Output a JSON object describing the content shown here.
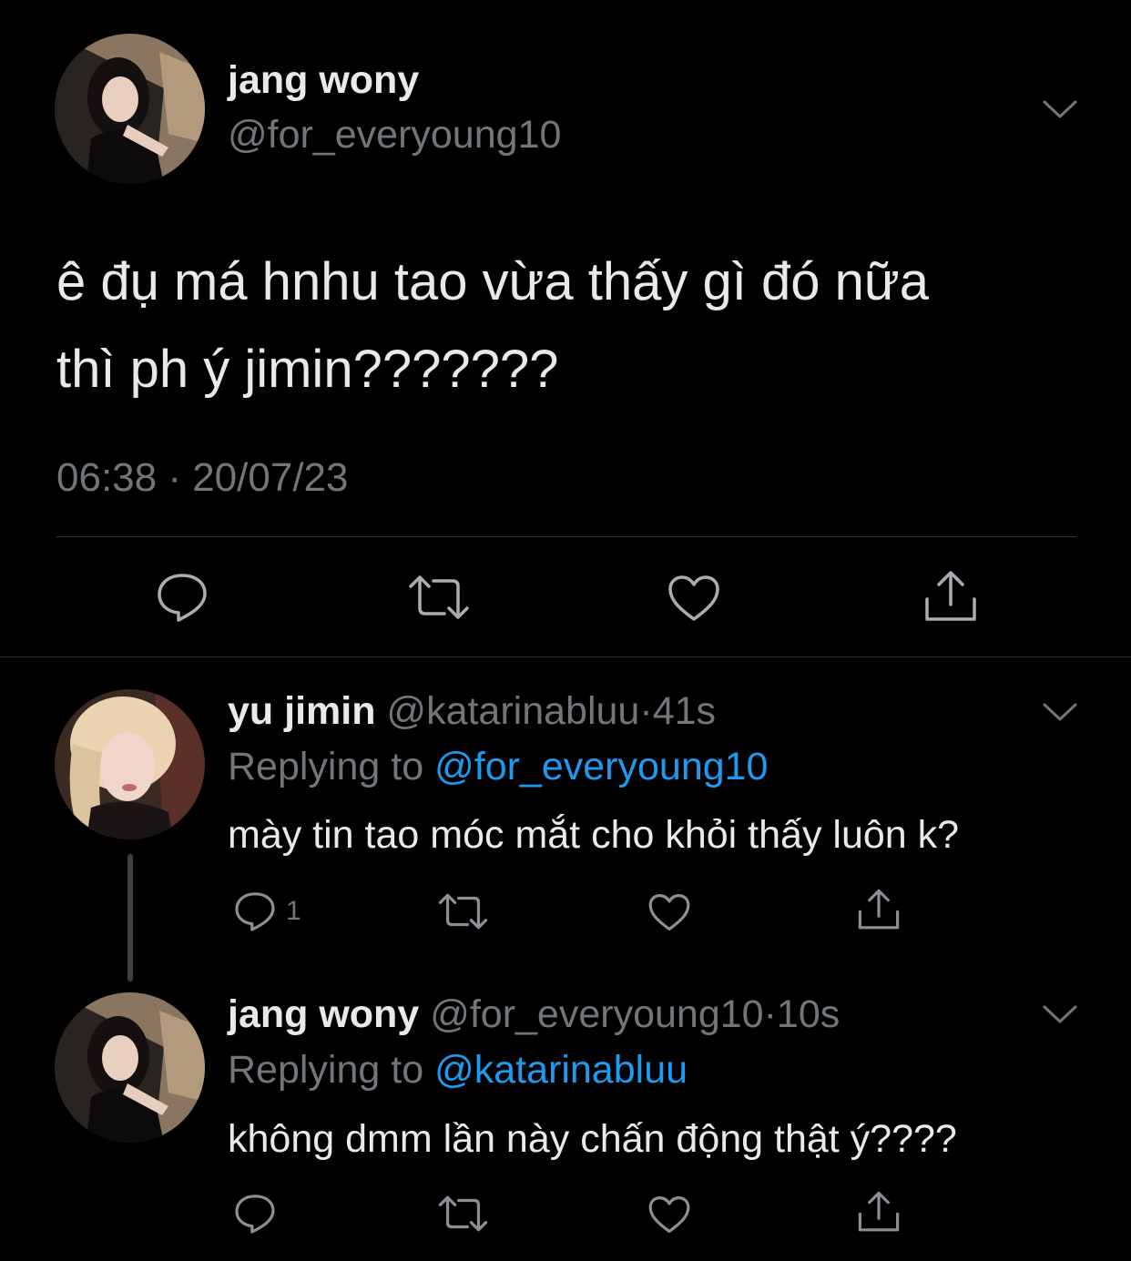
{
  "main_tweet": {
    "author_name": "jang wony",
    "author_handle": "@for_everyoung10",
    "text_line1": "ê đụ má hnhu tao vừa thấy gì đó nữa",
    "text_line2": "thì ph ý jimin???????",
    "timestamp": "06:38 · 20/07/23",
    "avatar_icon": "avatar-photo-jang-wony",
    "actions": [
      "reply-icon",
      "retweet-icon",
      "like-icon",
      "share-icon"
    ]
  },
  "replies": [
    {
      "author_name": "yu jimin",
      "author_handle": "@katarinabluu",
      "separator": "·",
      "time": "41s",
      "replying_prefix": "Replying to",
      "replying_to": "@for_everyoung10",
      "text": "mày tin tao móc mắt cho khỏi thấy luôn k?",
      "reply_count": "1",
      "avatar_icon": "avatar-photo-yu-jimin"
    },
    {
      "author_name": "jang wony",
      "author_handle": "@for_everyoung10",
      "separator": "·",
      "time": "10s",
      "replying_prefix": "Replying to",
      "replying_to": "@katarinabluu",
      "text": "không dmm lần này chấn động thật ý????",
      "reply_count": "",
      "avatar_icon": "avatar-photo-jang-wony"
    }
  ],
  "colors": {
    "background": "#000000",
    "text_primary": "#e7e9ea",
    "text_secondary": "#71767b",
    "mention": "#1d9bf0",
    "divider": "#2f3336"
  }
}
